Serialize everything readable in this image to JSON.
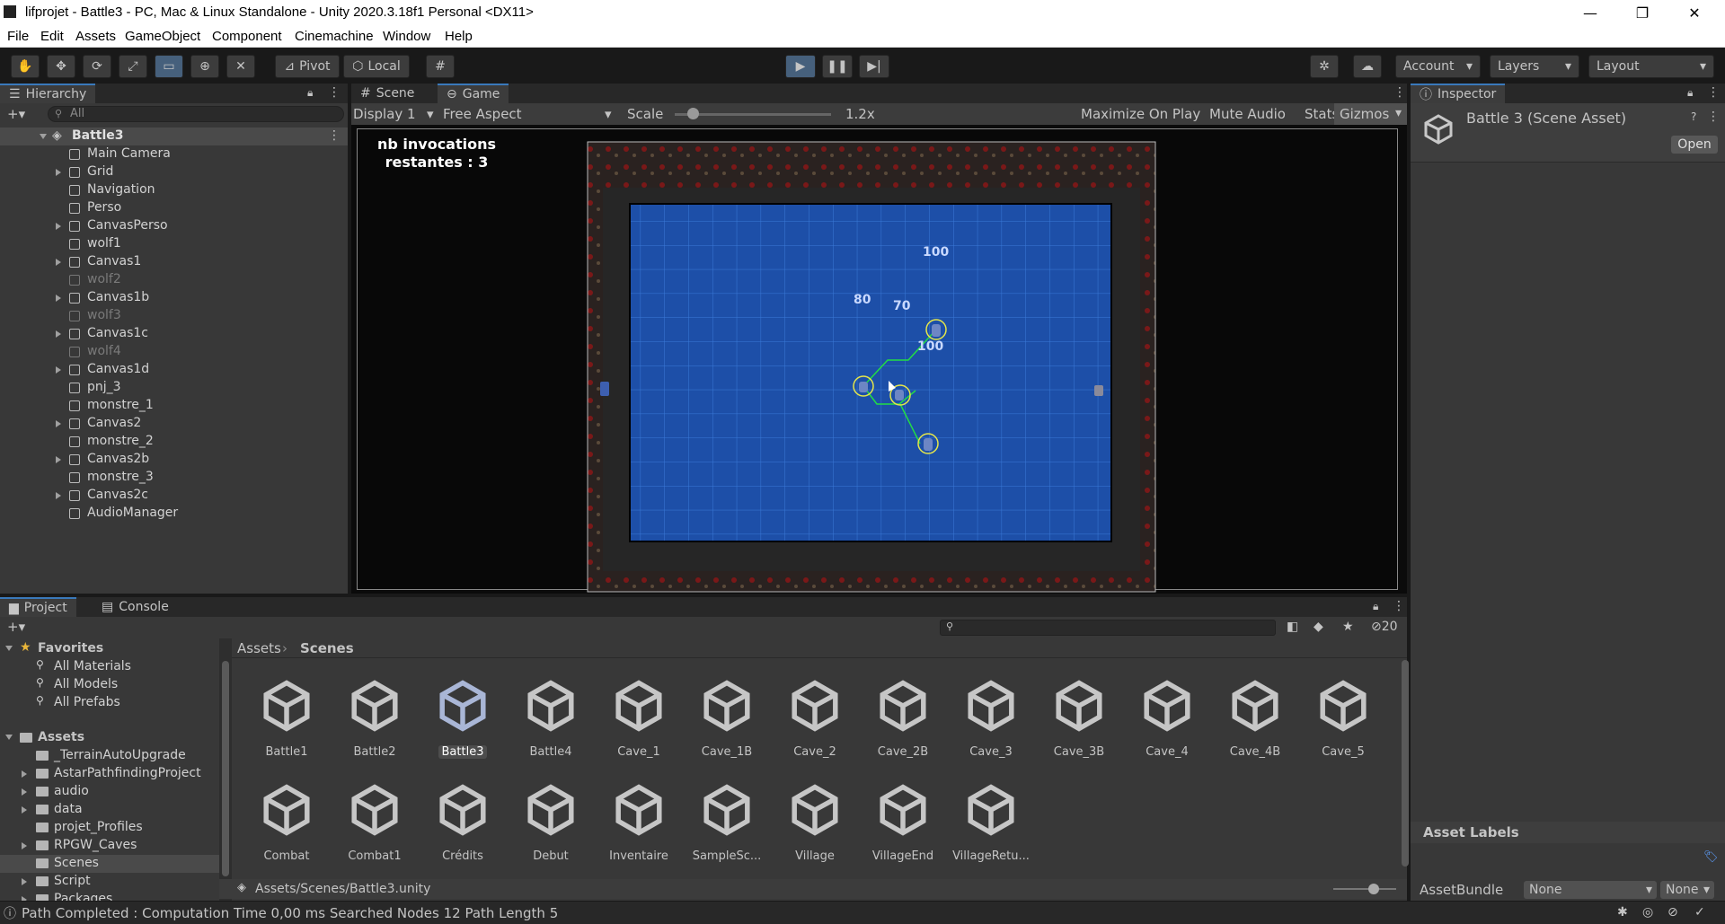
{
  "window": {
    "title": "lifprojet - Battle3 - PC, Mac & Linux Standalone - Unity 2020.3.18f1 Personal <DX11>",
    "minimize": "—",
    "maximize": "❐",
    "close": "✕"
  },
  "menu": [
    "File",
    "Edit",
    "Assets",
    "GameObject",
    "Component",
    "Cinemachine",
    "Window",
    "Help"
  ],
  "toolbar": {
    "pivot": "Pivot",
    "local": "Local",
    "account": "Account",
    "layers": "Layers",
    "layout": "Layout"
  },
  "hierarchy": {
    "tab": "Hierarchy",
    "search_placeholder": "All",
    "scene": "Battle3",
    "items": [
      {
        "label": "Main Camera",
        "dim": false,
        "expandable": false
      },
      {
        "label": "Grid",
        "dim": false,
        "expandable": true
      },
      {
        "label": "Navigation",
        "dim": false,
        "expandable": false
      },
      {
        "label": "Perso",
        "dim": false,
        "expandable": false
      },
      {
        "label": "CanvasPerso",
        "dim": false,
        "expandable": true
      },
      {
        "label": "wolf1",
        "dim": false,
        "expandable": false
      },
      {
        "label": "Canvas1",
        "dim": false,
        "expandable": true
      },
      {
        "label": "wolf2",
        "dim": true,
        "expandable": false
      },
      {
        "label": "Canvas1b",
        "dim": false,
        "expandable": true
      },
      {
        "label": "wolf3",
        "dim": true,
        "expandable": false
      },
      {
        "label": "Canvas1c",
        "dim": false,
        "expandable": true
      },
      {
        "label": "wolf4",
        "dim": true,
        "expandable": false
      },
      {
        "label": "Canvas1d",
        "dim": false,
        "expandable": true
      },
      {
        "label": "pnj_3",
        "dim": false,
        "expandable": false
      },
      {
        "label": "monstre_1",
        "dim": false,
        "expandable": false
      },
      {
        "label": "Canvas2",
        "dim": false,
        "expandable": true
      },
      {
        "label": "monstre_2",
        "dim": false,
        "expandable": false
      },
      {
        "label": "Canvas2b",
        "dim": false,
        "expandable": true
      },
      {
        "label": "monstre_3",
        "dim": false,
        "expandable": false
      },
      {
        "label": "Canvas2c",
        "dim": false,
        "expandable": true
      },
      {
        "label": "AudioManager",
        "dim": false,
        "expandable": false
      }
    ]
  },
  "view_tabs": {
    "scene": "Scene",
    "game": "Game"
  },
  "game_toolbar": {
    "display": "Display 1",
    "aspect": "Free Aspect",
    "scale_label": "Scale",
    "scale_value": "1.2x",
    "maximize": "Maximize On Play",
    "mute": "Mute Audio",
    "stats": "Stats",
    "gizmos": "Gizmos"
  },
  "game_view": {
    "hud_line1": "nb invocations",
    "hud_line2": "restantes : 3",
    "labels": [
      "100",
      "80",
      "70",
      "100"
    ]
  },
  "inspector": {
    "tab": "Inspector",
    "title": "Battle 3 (Scene Asset)",
    "open": "Open",
    "asset_labels": "Asset Labels",
    "assetbundle": "AssetBundle",
    "bundle_value": "None",
    "variant_value": "None"
  },
  "project": {
    "tab_project": "Project",
    "tab_console": "Console",
    "hidden_count": "20",
    "favorites": "Favorites",
    "fav_items": [
      "All Materials",
      "All Models",
      "All Prefabs"
    ],
    "assets": "Assets",
    "folders": [
      {
        "label": "_TerrainAutoUpgrade",
        "expandable": false
      },
      {
        "label": "AstarPathfindingProject",
        "expandable": true
      },
      {
        "label": "audio",
        "expandable": true
      },
      {
        "label": "data",
        "expandable": true
      },
      {
        "label": "projet_Profiles",
        "expandable": false
      },
      {
        "label": "RPGW_Caves",
        "expandable": true
      },
      {
        "label": "Scenes",
        "expandable": false
      },
      {
        "label": "Script",
        "expandable": true
      },
      {
        "label": "Packages",
        "expandable": true
      }
    ],
    "breadcrumb": [
      "Assets",
      "Scenes"
    ],
    "row1": [
      "Battle1",
      "Battle2",
      "Battle3",
      "Battle4",
      "Cave_1",
      "Cave_1B",
      "Cave_2",
      "Cave_2B",
      "Cave_3",
      "Cave_3B",
      "Cave_4",
      "Cave_4B",
      "Cave_5"
    ],
    "row2": [
      "Combat",
      "Combat1",
      "Crédits",
      "Debut",
      "Inventaire",
      "SampleSc...",
      "Village",
      "VillageEnd",
      "VillageRetu..."
    ],
    "selected": "Battle3",
    "path": "Assets/Scenes/Battle3.unity"
  },
  "status": "Path Completed : Computation Time 0,00 ms Searched Nodes 12 Path Length 5",
  "colors": {
    "accent": "#3a79bb",
    "panel": "#383838",
    "dark": "#191919",
    "grid": "#1d4fa8"
  }
}
